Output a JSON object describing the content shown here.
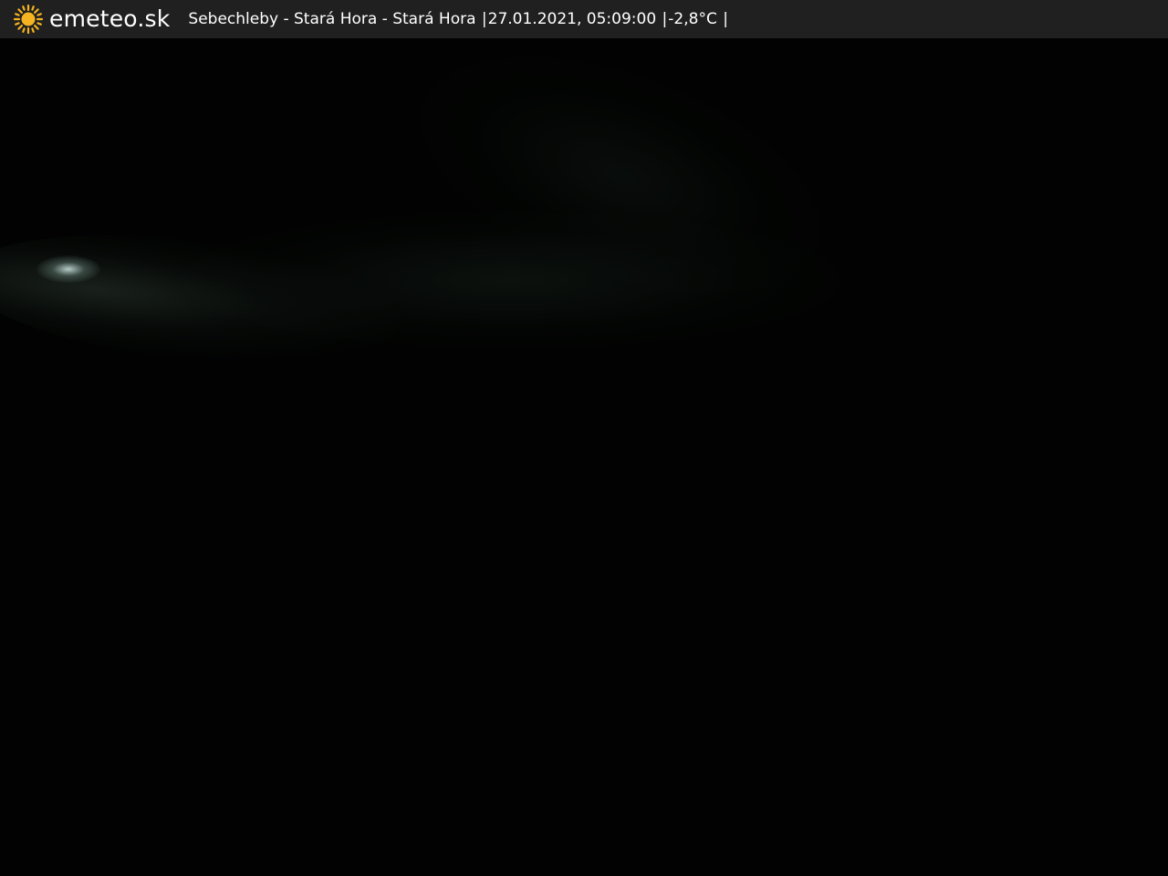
{
  "header": {
    "logo_icon": "sun-icon",
    "brand": "emeteo.sk",
    "location": "Sebechleby - Stará Hora - Stará Hora",
    "datetime": "27.01.2021, 05:09:00",
    "temperature": "-2,8°C",
    "separator": "|"
  },
  "colors": {
    "topbar_bg": "#202020",
    "sun": "#f5b321",
    "text": "#ffffff",
    "camera_bg": "#010201"
  }
}
